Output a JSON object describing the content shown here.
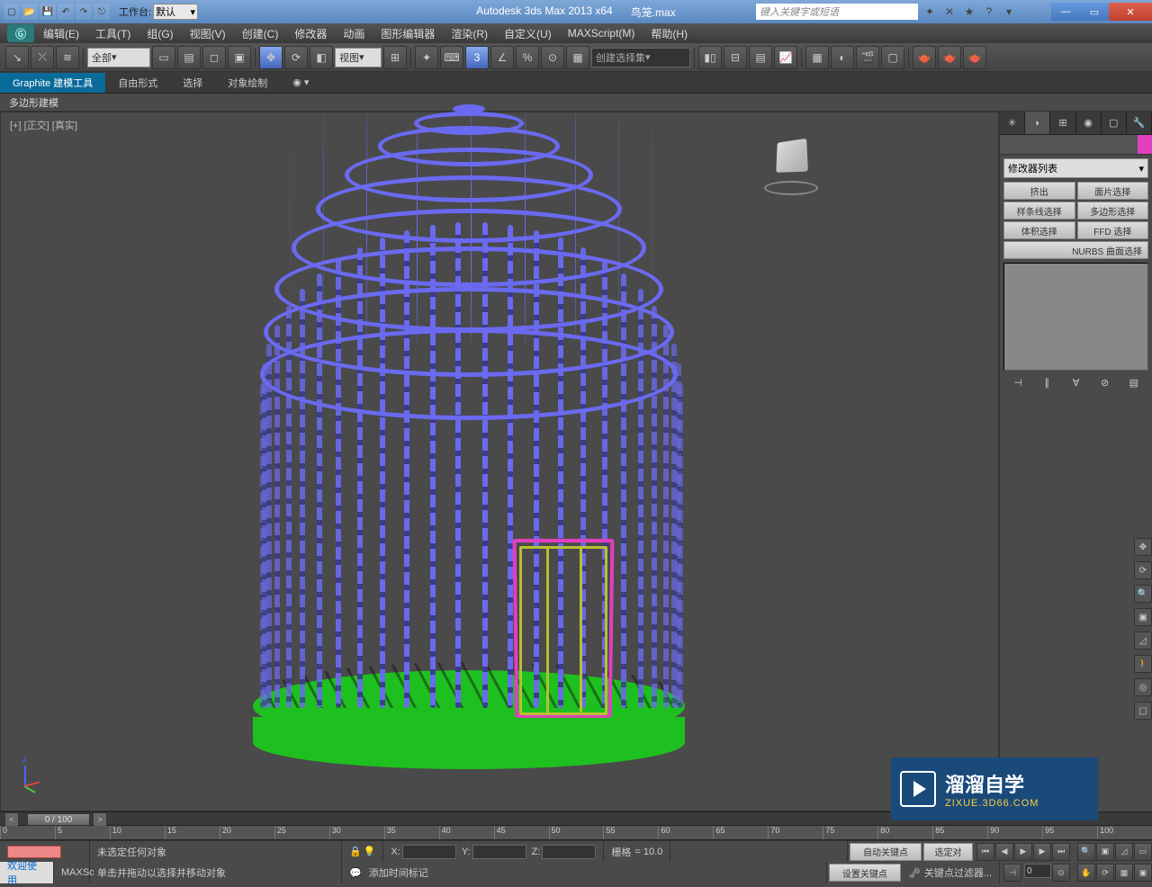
{
  "title": {
    "app": "Autodesk 3ds Max  2013 x64",
    "file": "鸟笼.max"
  },
  "workspace": {
    "label": "工作台:",
    "value": "默认"
  },
  "search_placeholder": "键入关键字或短语",
  "menus": [
    "编辑(E)",
    "工具(T)",
    "组(G)",
    "视图(V)",
    "创建(C)",
    "修改器",
    "动画",
    "图形编辑器",
    "渲染(R)",
    "自定义(U)",
    "MAXScript(M)",
    "帮助(H)"
  ],
  "toolbar": {
    "filter_all": "全部",
    "view_drop": "视图",
    "named_set": "创建选择集"
  },
  "ribbon": {
    "tabs": [
      "Graphite 建模工具",
      "自由形式",
      "选择",
      "对象绘制"
    ],
    "sub": "多边形建模"
  },
  "viewport_label": "[+] [正交] [真实]",
  "cmd": {
    "modlist": "修改器列表",
    "buttons": [
      "挤出",
      "面片选择",
      "样条线选择",
      "多边形选择",
      "体积选择",
      "FFD 选择"
    ],
    "nurbs": "NURBS 曲面选择"
  },
  "timeline": {
    "slider": "0 / 100",
    "ticks": [
      "0",
      "5",
      "10",
      "15",
      "20",
      "25",
      "30",
      "35",
      "40",
      "45",
      "50",
      "55",
      "60",
      "65",
      "70",
      "75",
      "80",
      "85",
      "90",
      "95",
      "100"
    ]
  },
  "status": {
    "none_selected": "未选定任何对象",
    "hint": "单击并拖动以选择并移动对象",
    "x": "X:",
    "y": "Y:",
    "z": "Z:",
    "grid_label": "栅格",
    "grid_val": "= 10.0",
    "add_time_tag": "添加时间标记",
    "autokey": "自动关键点",
    "setkey": "设置关键点",
    "sel_lock": "选定对",
    "key_filter": "关键点过滤器...",
    "welcome": "欢迎使用",
    "maxscript": "MAXSc"
  },
  "watermark": {
    "cn": "溜溜自学",
    "en": "ZIXUE.3D66.COM"
  }
}
